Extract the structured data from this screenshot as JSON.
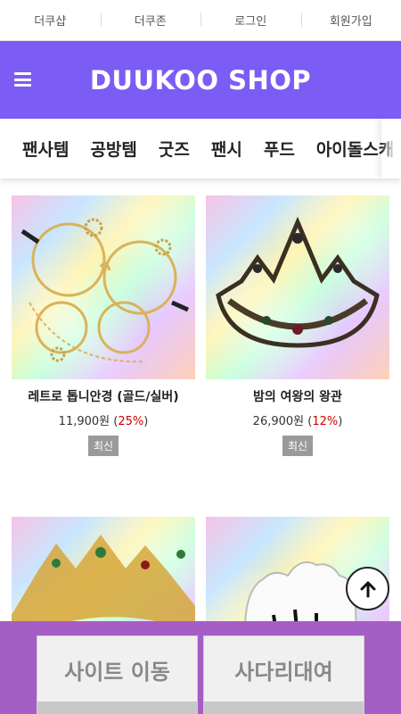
{
  "top_links": [
    "더쿠샵",
    "더쿠존",
    "로그인",
    "회원가입"
  ],
  "header": {
    "logo": "DUUKOO SHOP",
    "menu_icon": "hamburger-menu-icon",
    "brand_color": "#7b5cf5"
  },
  "categories": [
    "팬사템",
    "공방템",
    "굿즈",
    "팬시",
    "푸드",
    "아이돌스캐"
  ],
  "products": [
    {
      "name": "레트로 톱니안경 (골드/실버)",
      "price": "11,900원",
      "discount": "25%",
      "badge": "최신",
      "image": "retro-gear-glasses"
    },
    {
      "name": "밤의 여왕의 왕관",
      "price": "26,900원",
      "discount": "12%",
      "badge": "최신",
      "image": "dark-queen-crown"
    },
    {
      "name": "",
      "price": "",
      "discount": "",
      "badge": "",
      "image": "gold-crown"
    },
    {
      "name": "",
      "price": "",
      "discount": "",
      "badge": "",
      "image": "white-glove"
    }
  ],
  "price_open": "(",
  "price_close": ")",
  "scroll_top_icon": "arrow-up-icon",
  "bottom_buttons": {
    "site_move": "사이트 이동",
    "ladder_rent": "사다리대여"
  },
  "colors": {
    "bottom_bar": "#a55ec6",
    "discount": "#d10000",
    "badge": "#9a9a9a"
  }
}
